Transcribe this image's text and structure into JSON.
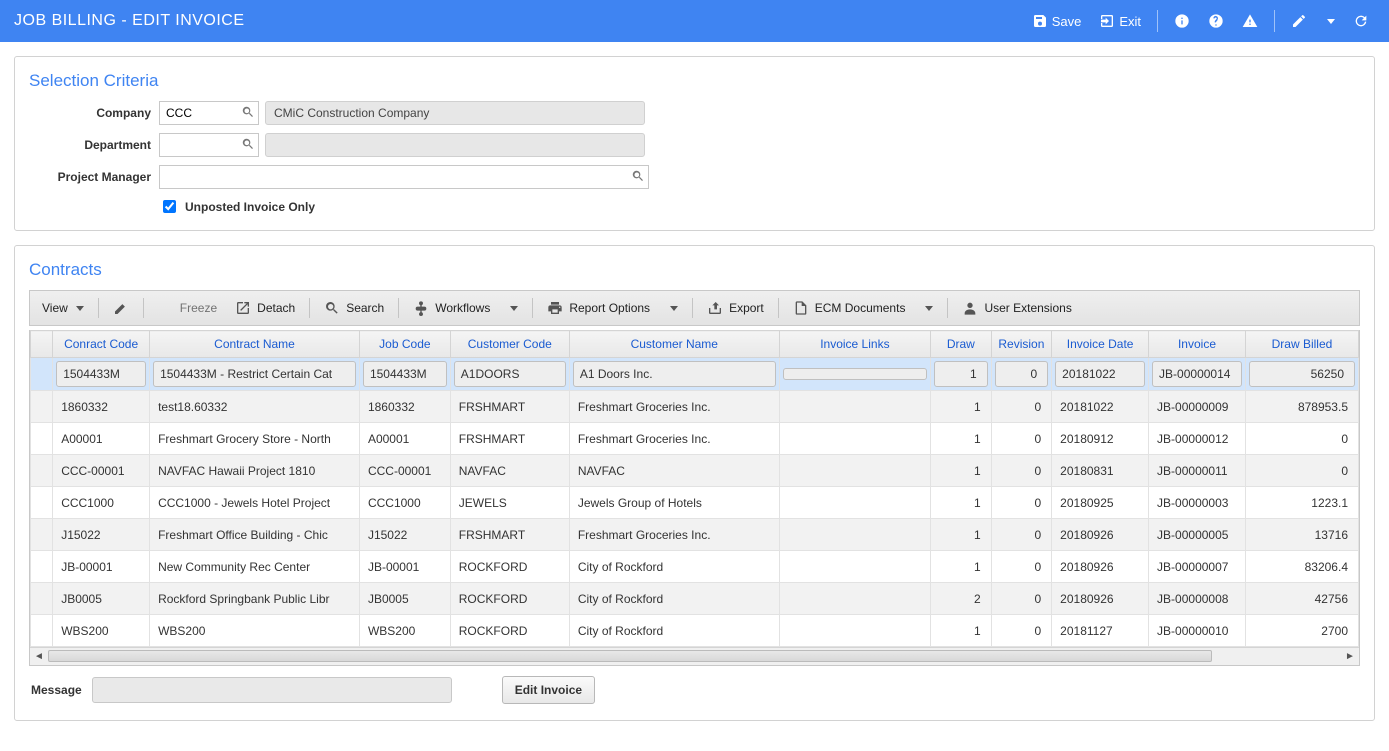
{
  "header": {
    "title": "JOB BILLING - EDIT INVOICE",
    "save_label": "Save",
    "exit_label": "Exit"
  },
  "selection": {
    "title": "Selection Criteria",
    "company_label": "Company",
    "company_value": "CCC",
    "company_display": "CMiC Construction Company",
    "department_label": "Department",
    "department_value": "",
    "department_display": "",
    "pm_label": "Project Manager",
    "pm_value": "",
    "unposted_label": "Unposted Invoice Only",
    "unposted_checked": true
  },
  "contracts": {
    "title": "Contracts",
    "toolbar": {
      "view": "View",
      "freeze": "Freeze",
      "detach": "Detach",
      "search": "Search",
      "workflows": "Workflows",
      "report_options": "Report Options",
      "export": "Export",
      "ecm_docs": "ECM Documents",
      "user_ext": "User Extensions"
    },
    "columns": {
      "contract_code": "Conract Code",
      "contract_name": "Contract Name",
      "job_code": "Job Code",
      "customer_code": "Customer Code",
      "customer_name": "Customer Name",
      "invoice_links": "Invoice Links",
      "draw": "Draw",
      "revision": "Revision",
      "invoice_date": "Invoice Date",
      "invoice": "Invoice",
      "draw_billed": "Draw Billed"
    },
    "rows": [
      {
        "contract_code": "1504433M",
        "contract_name": "1504433M - Restrict Certain Cat",
        "job_code": "1504433M",
        "customer_code": "A1DOORS",
        "customer_name": "A1 Doors Inc.",
        "invoice_links": "",
        "draw": "1",
        "revision": "0",
        "invoice_date": "20181022",
        "invoice": "JB-00000014",
        "draw_billed": "56250"
      },
      {
        "contract_code": "1860332",
        "contract_name": "test18.60332",
        "job_code": "1860332",
        "customer_code": "FRSHMART",
        "customer_name": "Freshmart Groceries Inc.",
        "invoice_links": "",
        "draw": "1",
        "revision": "0",
        "invoice_date": "20181022",
        "invoice": "JB-00000009",
        "draw_billed": "878953.5"
      },
      {
        "contract_code": "A00001",
        "contract_name": "Freshmart Grocery Store -  North",
        "job_code": "A00001",
        "customer_code": "FRSHMART",
        "customer_name": "Freshmart Groceries Inc.",
        "invoice_links": "",
        "draw": "1",
        "revision": "0",
        "invoice_date": "20180912",
        "invoice": "JB-00000012",
        "draw_billed": "0"
      },
      {
        "contract_code": "CCC-00001",
        "contract_name": "NAVFAC Hawaii Project 1810",
        "job_code": "CCC-00001",
        "customer_code": "NAVFAC",
        "customer_name": "NAVFAC",
        "invoice_links": "",
        "draw": "1",
        "revision": "0",
        "invoice_date": "20180831",
        "invoice": "JB-00000011",
        "draw_billed": "0"
      },
      {
        "contract_code": "CCC1000",
        "contract_name": "CCC1000 - Jewels Hotel Project",
        "job_code": "CCC1000",
        "customer_code": "JEWELS",
        "customer_name": "Jewels Group of Hotels",
        "invoice_links": "",
        "draw": "1",
        "revision": "0",
        "invoice_date": "20180925",
        "invoice": "JB-00000003",
        "draw_billed": "1223.1"
      },
      {
        "contract_code": "J15022",
        "contract_name": "Freshmart Office Building - Chic",
        "job_code": "J15022",
        "customer_code": "FRSHMART",
        "customer_name": "Freshmart Groceries Inc.",
        "invoice_links": "",
        "draw": "1",
        "revision": "0",
        "invoice_date": "20180926",
        "invoice": "JB-00000005",
        "draw_billed": "13716"
      },
      {
        "contract_code": "JB-00001",
        "contract_name": "New Community Rec Center",
        "job_code": "JB-00001",
        "customer_code": "ROCKFORD",
        "customer_name": "City of Rockford",
        "invoice_links": "",
        "draw": "1",
        "revision": "0",
        "invoice_date": "20180926",
        "invoice": "JB-00000007",
        "draw_billed": "83206.4"
      },
      {
        "contract_code": "JB0005",
        "contract_name": "Rockford Springbank Public Libr",
        "job_code": "JB0005",
        "customer_code": "ROCKFORD",
        "customer_name": "City of Rockford",
        "invoice_links": "",
        "draw": "2",
        "revision": "0",
        "invoice_date": "20180926",
        "invoice": "JB-00000008",
        "draw_billed": "42756"
      },
      {
        "contract_code": "WBS200",
        "contract_name": "WBS200",
        "job_code": "WBS200",
        "customer_code": "ROCKFORD",
        "customer_name": "City of Rockford",
        "invoice_links": "",
        "draw": "1",
        "revision": "0",
        "invoice_date": "20181127",
        "invoice": "JB-00000010",
        "draw_billed": "2700"
      }
    ]
  },
  "footer": {
    "message_label": "Message",
    "message_value": "",
    "edit_invoice_label": "Edit Invoice"
  }
}
